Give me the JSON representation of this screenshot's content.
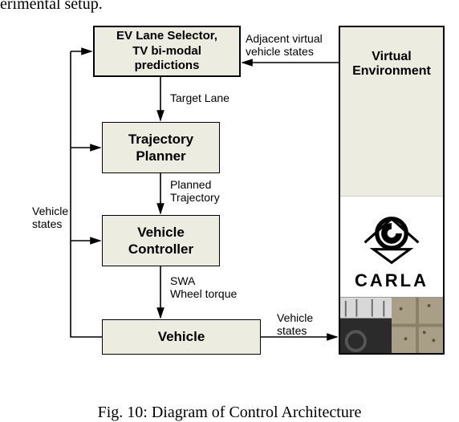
{
  "cut_top": "erimental setup.",
  "blocks": {
    "lane_selector": "EV Lane Selector,\nTV bi-modal\npredictions",
    "trajectory_planner": "Trajectory\nPlanner",
    "vehicle_controller": "Vehicle\nController",
    "vehicle": "Vehicle"
  },
  "right_panel": {
    "title": "Virtual\nEnvironment",
    "logo_text": "CARLA"
  },
  "edges": {
    "adj_virtual": "Adjacent virtual\nvehicle states",
    "target_lane": "Target Lane",
    "planned_traj": "Planned\nTrajectory",
    "swa_torque": "SWA\nWheel torque",
    "vehicle_states_left": "Vehicle\nstates",
    "vehicle_states_right": "Vehicle\nstates"
  },
  "caption": "Fig. 10: Diagram of Control Architecture"
}
